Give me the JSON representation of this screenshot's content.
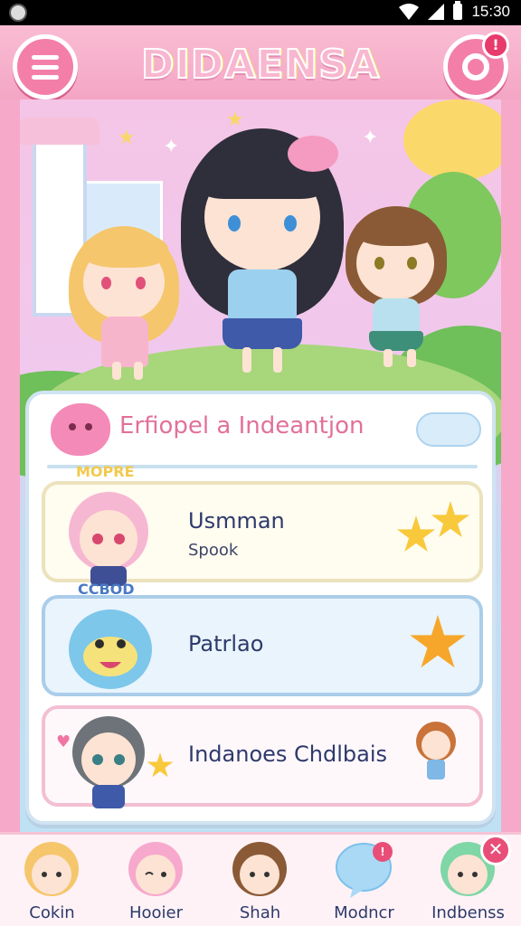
{
  "status_bar": {
    "time": "15:30"
  },
  "header": {
    "title": "DIDAENSA",
    "notification_badge": "!"
  },
  "panel": {
    "title": "Erfiopel a Indeantjon",
    "entries": [
      {
        "name": "Usmman",
        "subtitle": "Spook",
        "avatar_tag": "MOPRE"
      },
      {
        "name": "Patrlao",
        "subtitle": "",
        "avatar_tag": "CCBOD"
      },
      {
        "name": "Indanoes Chdlbais",
        "subtitle": "",
        "avatar_tag": ""
      }
    ]
  },
  "bottom_nav": {
    "items": [
      {
        "label": "Cokin",
        "icon": "blonde-girl-avatar"
      },
      {
        "label": "Hooier",
        "icon": "pink-girl-avatar"
      },
      {
        "label": "Shah",
        "icon": "brown-girl-avatar"
      },
      {
        "label": "Modncr",
        "icon": "speech-bubble-icon"
      },
      {
        "label": "Indbenss",
        "icon": "green-girl-avatar"
      }
    ],
    "close_label": "✕",
    "bubble_badge": "!"
  },
  "colors": {
    "primary_pink": "#f37fa9",
    "title_pink": "#e2719a",
    "text_navy": "#2d3a6b",
    "panel_border": "#cfe3f2"
  }
}
